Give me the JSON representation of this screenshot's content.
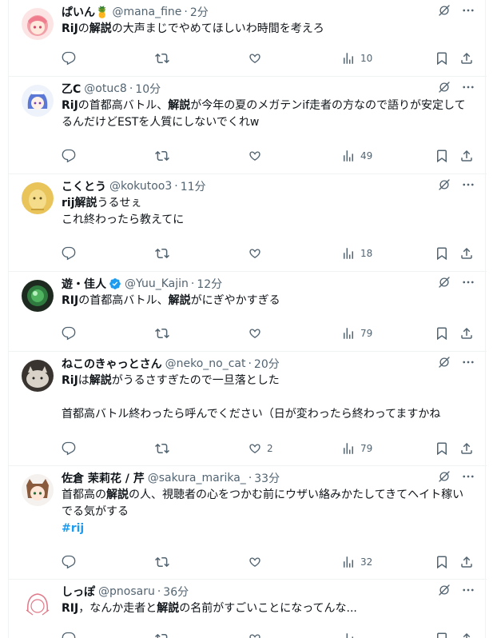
{
  "tweets": [
    {
      "name": "ぱいん🍍",
      "handle": "@mana_fine",
      "time": "2分",
      "text_html": "<b>RiJ</b>の<b>解説</b>の大声まじでやめてほしいわ時間を考えろ",
      "replies": "",
      "likes": "",
      "views": "10",
      "verified": false,
      "avatar": "pink-hair-anime-avatar"
    },
    {
      "name": "乙C",
      "handle": "@otuc8",
      "time": "10分",
      "text_html": "<b>RiJ</b>の首都高バトル、<b>解説</b>が今年の夏のメガテンif走者の方なので語りが安定してるんだけどESTを人質にしないでくれw",
      "replies": "",
      "likes": "",
      "views": "49",
      "verified": false,
      "avatar": "blue-hair-anime-avatar"
    },
    {
      "name": "こくとう",
      "handle": "@kokutoo3",
      "time": "11分",
      "text_html": "<b>rij解説</b>うるせぇ\nこれ終わったら教えてに",
      "replies": "",
      "likes": "",
      "views": "18",
      "verified": false,
      "avatar": "yellow-character-avatar"
    },
    {
      "name": "遊・佳人",
      "handle": "@Yuu_Kajin",
      "time": "12分",
      "text_html": "<b>RIJ</b>の首都高バトル、<b>解説</b>がにぎやかすぎる",
      "replies": "",
      "likes": "",
      "views": "79",
      "verified": true,
      "avatar": "dark-green-orb-avatar"
    },
    {
      "name": "ねこのきゃっとさん",
      "handle": "@neko_no_cat",
      "time": "20分",
      "text_html": "<b>RiJ</b>は<b>解説</b>がうるさすぎたので一旦落とした\n\n首都高バトル終わったら呼んでください（日が変わったら終わってますかね",
      "replies": "",
      "likes": "2",
      "views": "79",
      "verified": false,
      "avatar": "cat-photo-avatar"
    },
    {
      "name": "佐倉 茉莉花 / 芹",
      "handle": "@sakura_marika_",
      "time": "33分",
      "text_html": "首都高の<b>解説</b>の人、視聴者の心をつかむ前にウザい絡みかたしてきてヘイト稼いでる気がする\n<span class=\"hashtag\">#rij</span>",
      "replies": "",
      "likes": "",
      "views": "32",
      "verified": false,
      "avatar": "brown-hair-anime-avatar"
    },
    {
      "name": "しっぽ",
      "handle": "@pnosaru",
      "time": "36分",
      "text_html": "<b>RIJ</b>，なんか走者と<b>解説</b>の名前がすごいことになってんな...",
      "replies": "",
      "likes": "",
      "views": "",
      "verified": false,
      "avatar": "sketch-anime-avatar"
    }
  ],
  "colors": {
    "text": "#0f1419",
    "muted": "#536471",
    "link": "#1d9bf0",
    "border": "#eff3f4"
  }
}
